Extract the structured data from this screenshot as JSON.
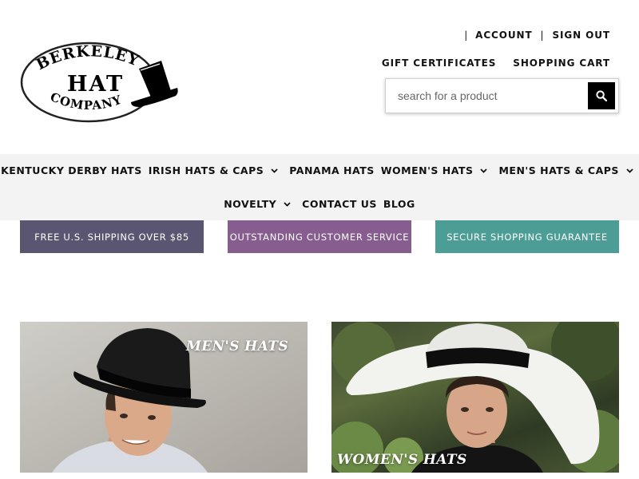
{
  "header": {
    "logo": {
      "line1": "BERKELEY",
      "line2": "HAT",
      "line3": "COMPANY"
    },
    "account_links": {
      "separator": "|",
      "account": "ACCOUNT",
      "sign_out": "SIGN OUT"
    },
    "utility_links": {
      "gift_certificates": "GIFT CERTIFICATES",
      "shopping_cart": "SHOPPING CART"
    },
    "search": {
      "placeholder": "search for a product",
      "value": "",
      "button_icon": "search-icon"
    }
  },
  "nav": {
    "row1": [
      {
        "label": "KENTUCKY DERBY HATS",
        "dropdown": false
      },
      {
        "label": "IRISH HATS & CAPS",
        "dropdown": true
      },
      {
        "label": "PANAMA HATS",
        "dropdown": false
      },
      {
        "label": "WOMEN'S HATS",
        "dropdown": true
      },
      {
        "label": "MEN'S HATS & CAPS",
        "dropdown": true
      }
    ],
    "row2": [
      {
        "label": "NOVELTY",
        "dropdown": true
      },
      {
        "label": "CONTACT US",
        "dropdown": false
      },
      {
        "label": "BLOG",
        "dropdown": false
      }
    ]
  },
  "promos": [
    {
      "text": "FREE U.S. SHIPPING OVER $85",
      "color": "#5a5570"
    },
    {
      "text": "OUTSTANDING CUSTOMER SERVICE",
      "color": "#865d8e"
    },
    {
      "text": "SECURE SHOPPING GUARANTEE",
      "color": "#4c9d95"
    }
  ],
  "categories": [
    {
      "label": "MEN'S HATS"
    },
    {
      "label": "WOMEN'S HATS"
    }
  ]
}
